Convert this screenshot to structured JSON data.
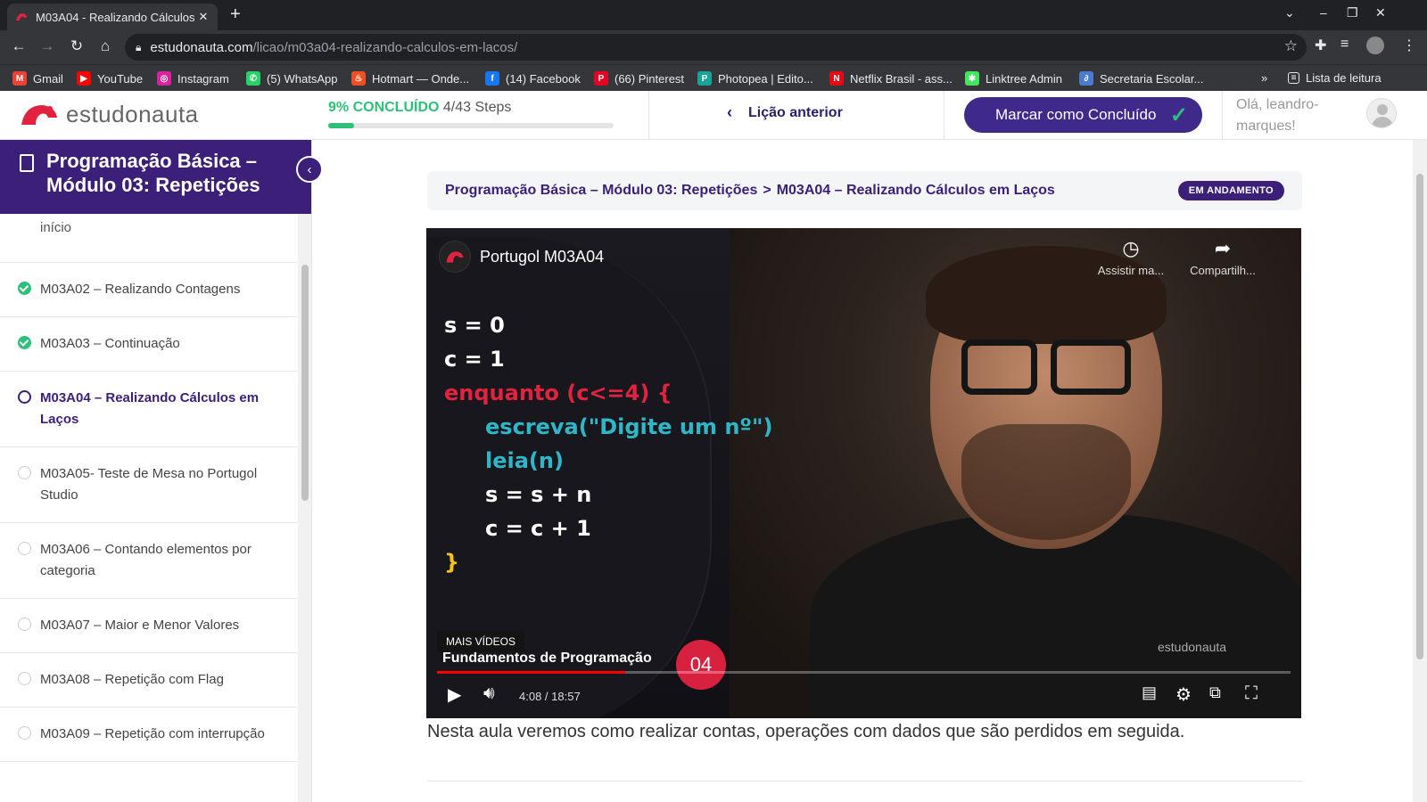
{
  "browser": {
    "tab_title": "M03A04 - Realizando Cálculos",
    "tab_close": "✕",
    "new_tab": "+",
    "url_host": "estudonauta.com",
    "url_path": "/licao/m03a04-realizando-calculos-em-lacos/",
    "bookmarks": [
      {
        "label": "Gmail",
        "color": "#ea4335",
        "glyph": "M"
      },
      {
        "label": "YouTube",
        "color": "#ff0000",
        "glyph": "▶"
      },
      {
        "label": "Instagram",
        "color": "#d6249f",
        "glyph": "◎"
      },
      {
        "label": "(5) WhatsApp",
        "color": "#25d366",
        "glyph": "✆"
      },
      {
        "label": "Hotmart — Onde...",
        "color": "#f04e23",
        "glyph": "♨"
      },
      {
        "label": "(14) Facebook",
        "color": "#1877f2",
        "glyph": "f"
      },
      {
        "label": "(66) Pinterest",
        "color": "#e60023",
        "glyph": "P"
      },
      {
        "label": "Photopea | Edito...",
        "color": "#18a497",
        "glyph": "P"
      },
      {
        "label": "Netflix Brasil - ass...",
        "color": "#e50914",
        "glyph": "N"
      },
      {
        "label": "Linktree Admin",
        "color": "#43e55e",
        "glyph": "✱"
      },
      {
        "label": "Secretaria Escolar...",
        "color": "#4a7bd0",
        "glyph": "∂"
      }
    ],
    "bookmarks_more": "»",
    "reading_list": "Lista de leitura"
  },
  "header": {
    "logo_text": "estudonauta",
    "progress_percent_label": "9% CONCLUÍDO",
    "progress_steps": "4/43 Steps",
    "progress_fraction": 0.09,
    "prev_lesson": "Lição anterior",
    "mark_complete": "Marcar como Concluído",
    "greeting": "Olá, leandro-marques!"
  },
  "sidebar": {
    "title": "Programação Básica – Módulo 03: Repetições",
    "partial_item": "início",
    "lessons": [
      {
        "label": "M03A02 – Realizando Contagens",
        "status": "done"
      },
      {
        "label": "M03A03 – Continuação",
        "status": "done"
      },
      {
        "label": "M03A04 – Realizando Cálculos em Laços",
        "status": "current"
      },
      {
        "label": "M03A05- Teste de Mesa no Portugol Studio",
        "status": "todo"
      },
      {
        "label": "M03A06 – Contando elementos por categoria",
        "status": "todo"
      },
      {
        "label": "M03A07 – Maior e Menor Valores",
        "status": "todo"
      },
      {
        "label": "M03A08 – Repetição com Flag",
        "status": "todo"
      },
      {
        "label": "M03A09 – Repetição com interrupção",
        "status": "todo"
      }
    ]
  },
  "breadcrumb": {
    "course": "Programação Básica – Módulo 03: Repetições",
    "separator": ">",
    "lesson": "M03A04 – Realizando Cálculos em Laços",
    "badge": "EM ANDAMENTO"
  },
  "video": {
    "title": "Portugol M03A04",
    "watch_later": "Assistir ma...",
    "share": "Compartilh...",
    "code_lines": [
      "s = 0",
      "c = 1",
      "enquanto (c<=4) {",
      "escreva(\"Digite um nº\")",
      "leia(n)",
      "s = s + n",
      "c = c + 1",
      "}"
    ],
    "more_videos": "MAIS VÍDEOS",
    "lower_third": "Fundamentos de Programação",
    "episode": "04",
    "watermark": "estudonauta",
    "time": "4:08 / 18:57",
    "played_fraction": 0.22
  },
  "description": "Nesta aula veremos como realizar contas, operações com dados que são perdidos em seguida."
}
